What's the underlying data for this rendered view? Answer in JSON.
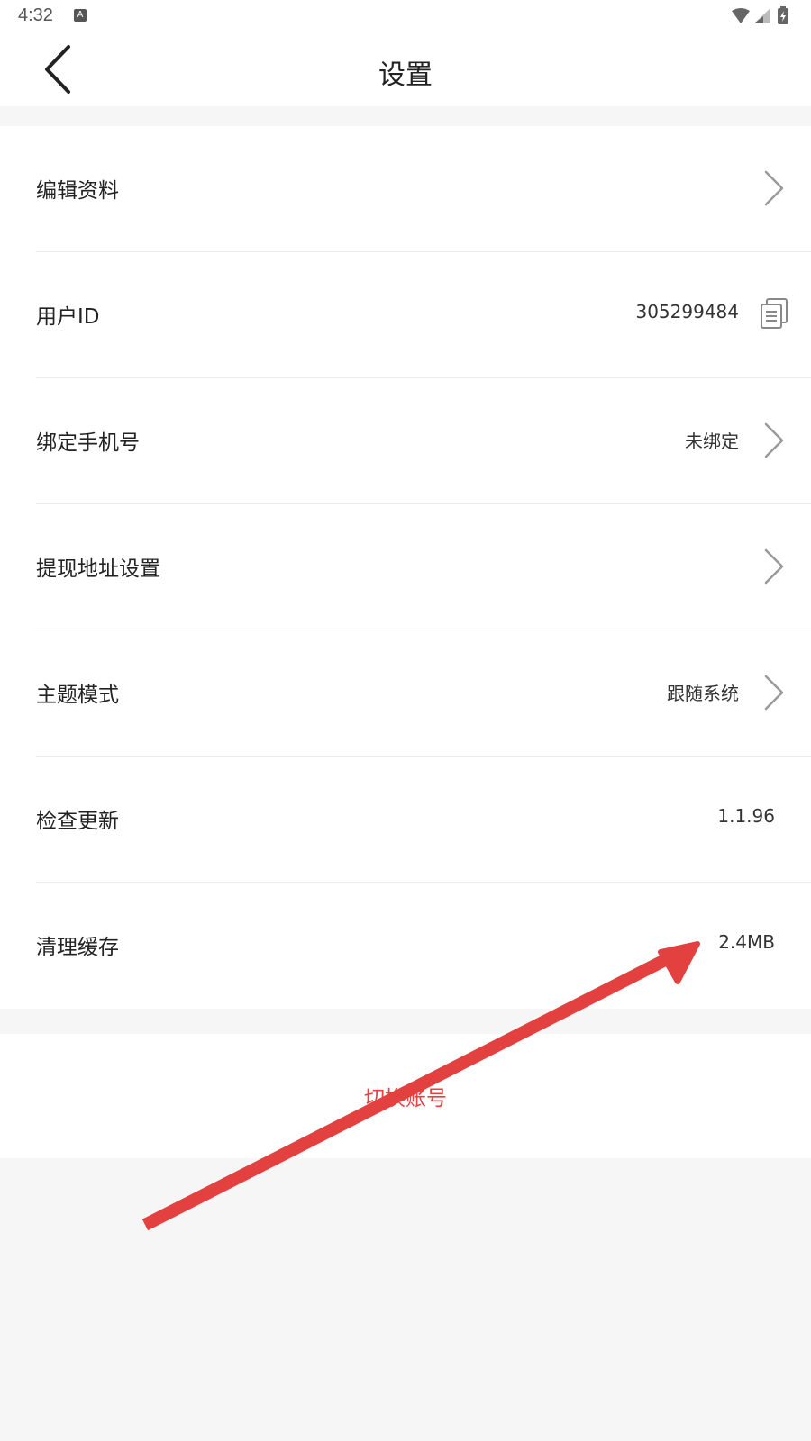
{
  "status_bar": {
    "time": "4:32",
    "notification_icon": "a-icon",
    "icons": [
      "wifi-icon",
      "signal-icon",
      "battery-charging-icon"
    ]
  },
  "header": {
    "title": "设置",
    "back_icon": "chevron-left-icon"
  },
  "settings": {
    "items": [
      {
        "label": "编辑资料",
        "value": "",
        "icon": "chevron-right-icon"
      },
      {
        "label": "用户ID",
        "value": "305299484",
        "icon": "copy-icon"
      },
      {
        "label": "绑定手机号",
        "value": "未绑定",
        "icon": "chevron-right-icon"
      },
      {
        "label": "提现地址设置",
        "value": "",
        "icon": "chevron-right-icon"
      },
      {
        "label": "主题模式",
        "value": "跟随系统",
        "icon": "chevron-right-icon"
      },
      {
        "label": "检查更新",
        "value": "1.1.96",
        "icon": ""
      },
      {
        "label": "清理缓存",
        "value": "2.4MB",
        "icon": ""
      }
    ]
  },
  "actions": {
    "switch_account_label": "切换账号"
  },
  "annotation": {
    "arrow_color": "#e34040"
  },
  "colors": {
    "accent_red": "#e84142",
    "background": "#f5f6f5"
  }
}
